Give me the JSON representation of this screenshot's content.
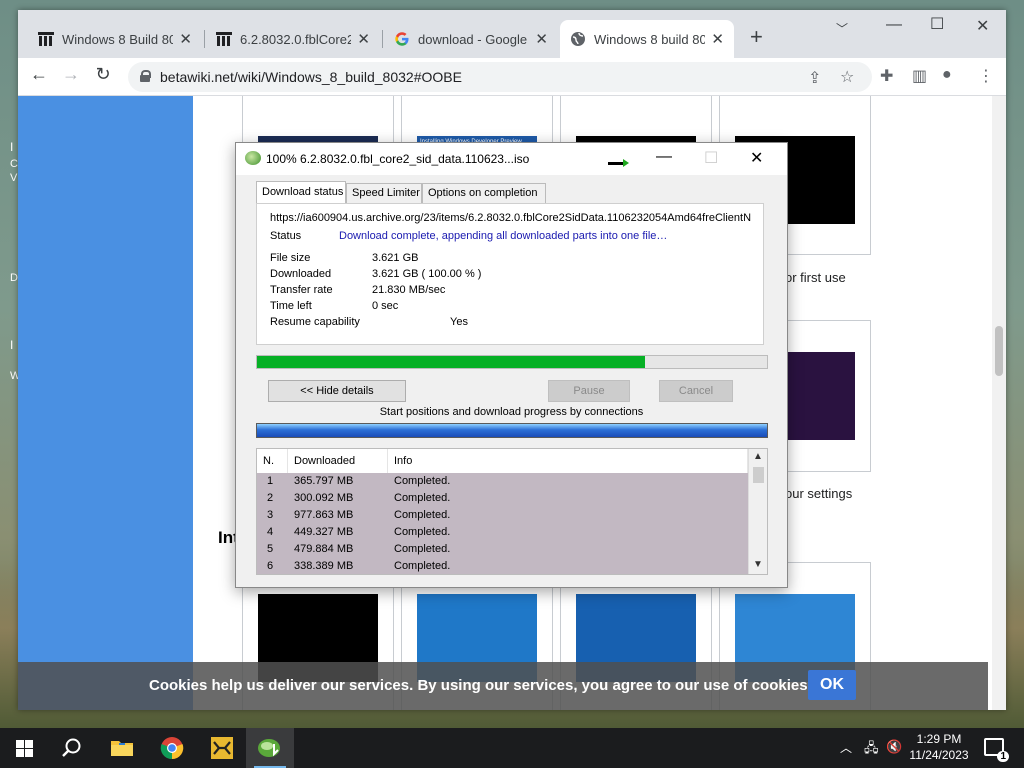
{
  "desktop": {
    "side_text": [
      "I",
      "C",
      "V",
      "D",
      "I",
      "W"
    ]
  },
  "browser": {
    "tabs": [
      {
        "title": "Windows 8 Build 80",
        "favicon": "museum-icon"
      },
      {
        "title": "6.2.8032.0.fblCore2S",
        "favicon": "museum-icon"
      },
      {
        "title": "download - Google",
        "favicon": "google-icon"
      },
      {
        "title": "Windows 8 build 80",
        "favicon": "globe-icon"
      }
    ],
    "close_glyph": "✕",
    "new_tab_glyph": "+",
    "url": "betawiki.net/wiki/Windows_8_build_8032#OOBE"
  },
  "page": {
    "captions": {
      "first_use": "or first use",
      "settings": "our settings"
    },
    "heading_partial": "Int",
    "cookie_message": "Cookies help us deliver our services. By using our services, you agree to our use of cookies.",
    "cookie_ok": "OK",
    "install_thumb_text": "Installing Windows Developer Preview"
  },
  "idm": {
    "title": "100% 6.2.8032.0.fbl_core2_sid_data.110623...iso",
    "tabs": [
      "Download status",
      "Speed Limiter",
      "Options on completion"
    ],
    "url": "https://ia600904.us.archive.org/23/items/6.2.8032.0.fblCore2SidData.1106232054Amd64freClientN",
    "status_label": "Status",
    "status_value": "Download complete, appending all downloaded parts into one file…",
    "fields": [
      {
        "label": "File size",
        "value": "3.621  GB"
      },
      {
        "label": "Downloaded",
        "value": "3.621  GB  ( 100.00 % )"
      },
      {
        "label": "Transfer rate",
        "value": "21.830  MB/sec"
      },
      {
        "label": "Time left",
        "value": "0 sec"
      }
    ],
    "resume_label": "Resume capability",
    "resume_value": "Yes",
    "progress_fraction": 0.76,
    "buttons": {
      "hide_details": "<< Hide details",
      "pause": "Pause",
      "cancel": "Cancel"
    },
    "connections_label": "Start positions and download progress by connections",
    "table_headers": [
      "N.",
      "Downloaded",
      "Info"
    ],
    "rows": [
      {
        "n": "1",
        "downloaded": "365.797  MB",
        "info": "Completed."
      },
      {
        "n": "2",
        "downloaded": "300.092  MB",
        "info": "Completed."
      },
      {
        "n": "3",
        "downloaded": "977.863  MB",
        "info": "Completed."
      },
      {
        "n": "4",
        "downloaded": "449.327  MB",
        "info": "Completed."
      },
      {
        "n": "5",
        "downloaded": "479.884  MB",
        "info": "Completed."
      },
      {
        "n": "6",
        "downloaded": "338.389  MB",
        "info": "Completed."
      }
    ]
  },
  "taskbar": {
    "time": "1:29 PM",
    "date": "11/24/2023",
    "notification_count": "1"
  },
  "colors": {
    "progress_green": "#06b025",
    "wiki_blue": "#4a90e2",
    "cookie_ok_blue": "#3a76d6"
  }
}
